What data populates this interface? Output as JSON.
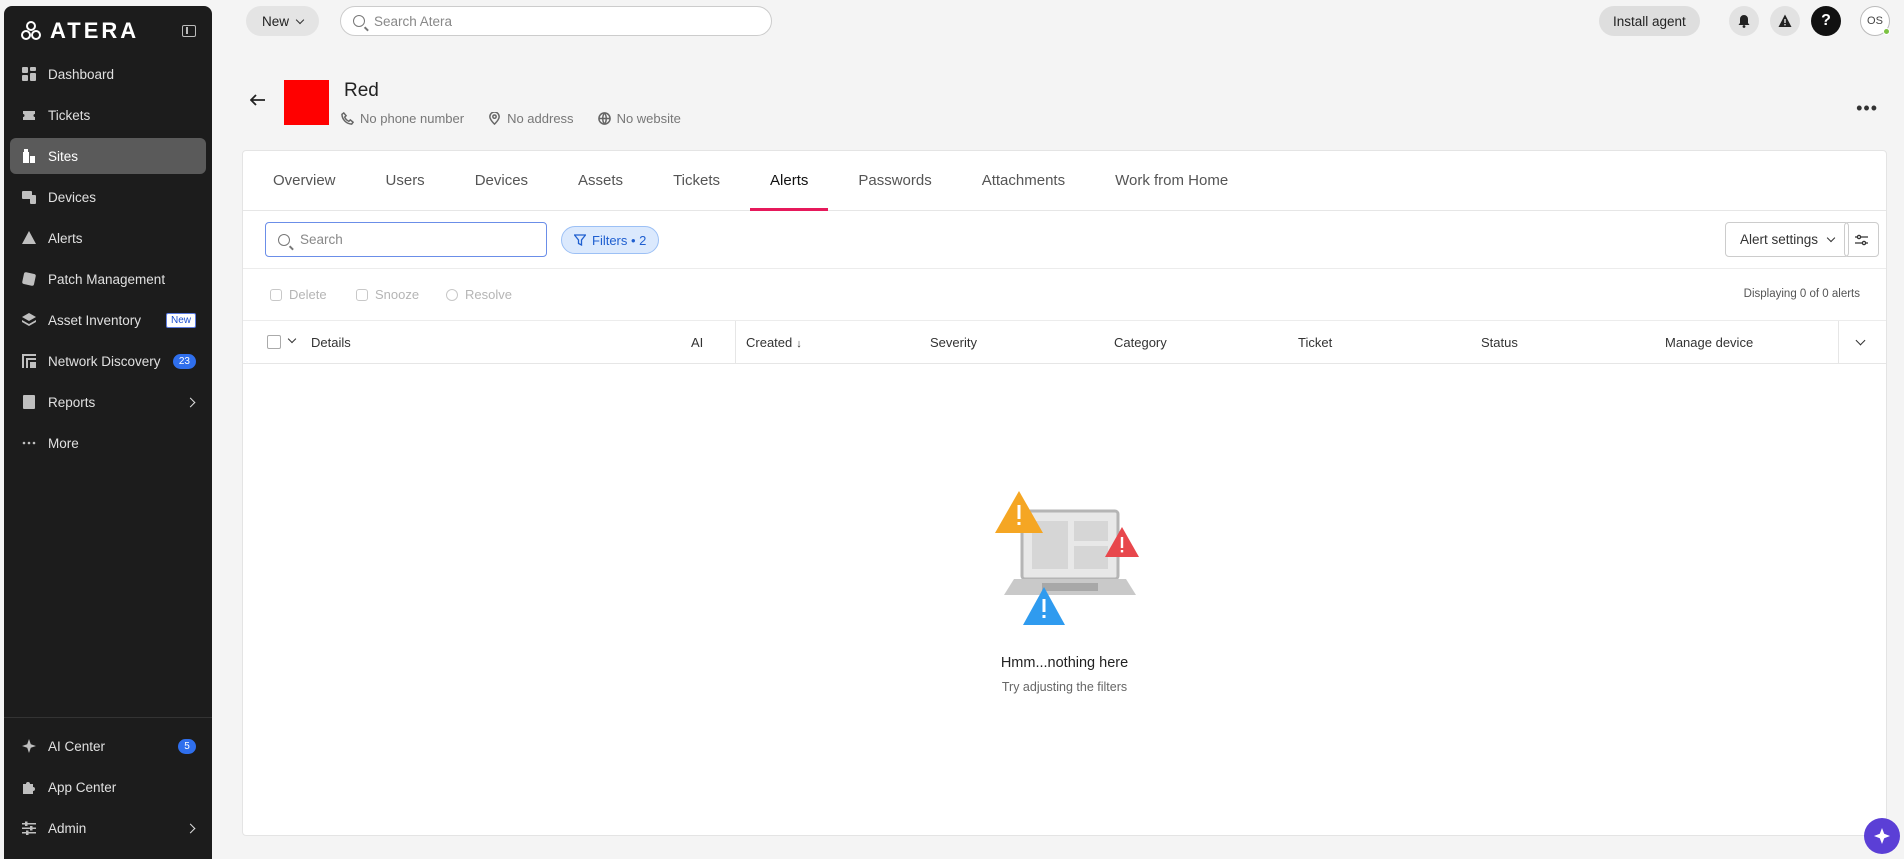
{
  "brand": {
    "name": "ATERA"
  },
  "sidebar": {
    "items": [
      {
        "label": "Dashboard",
        "icon": "dashboard-icon"
      },
      {
        "label": "Tickets",
        "icon": "ticket-icon"
      },
      {
        "label": "Sites",
        "icon": "building-icon",
        "active": true
      },
      {
        "label": "Devices",
        "icon": "devices-icon"
      },
      {
        "label": "Alerts",
        "icon": "alert-icon"
      },
      {
        "label": "Patch Management",
        "icon": "patch-icon"
      },
      {
        "label": "Asset Inventory",
        "icon": "layers-icon",
        "badge": "New"
      },
      {
        "label": "Network Discovery",
        "icon": "network-icon",
        "count": "23"
      },
      {
        "label": "Reports",
        "icon": "reports-icon"
      },
      {
        "label": "More",
        "icon": "more-icon"
      }
    ],
    "bottom": [
      {
        "label": "AI Center",
        "icon": "sparkle-icon",
        "count": "5"
      },
      {
        "label": "App Center",
        "icon": "puzzle-icon"
      },
      {
        "label": "Admin",
        "icon": "sliders-icon"
      }
    ]
  },
  "topbar": {
    "new_label": "New",
    "search_placeholder": "Search Atera",
    "install_label": "Install agent",
    "help_label": "?",
    "avatar_initials": "OS"
  },
  "site": {
    "name": "Red",
    "color": "#ff0000",
    "phone": "No phone number",
    "address": "No address",
    "website": "No website"
  },
  "tabs": [
    "Overview",
    "Users",
    "Devices",
    "Assets",
    "Tickets",
    "Alerts",
    "Passwords",
    "Attachments",
    "Work from Home"
  ],
  "active_tab": "Alerts",
  "toolbar": {
    "search_placeholder": "Search",
    "filters_label": "Filters • 2",
    "alert_settings_label": "Alert settings"
  },
  "actions": {
    "delete": "Delete",
    "snooze": "Snooze",
    "resolve": "Resolve",
    "display_count": "Displaying 0 of 0 alerts"
  },
  "table": {
    "columns": [
      "Details",
      "AI",
      "Created",
      "Severity",
      "Category",
      "Ticket",
      "Status",
      "Manage device"
    ]
  },
  "empty_state": {
    "title": "Hmm...nothing here",
    "subtitle": "Try adjusting the filters"
  },
  "colors": {
    "accent_tab": "#e6195b",
    "sidebar_bg": "#1c1c1c",
    "filter_chip": "#dbe9fd",
    "fab": "#5b3fd6"
  }
}
